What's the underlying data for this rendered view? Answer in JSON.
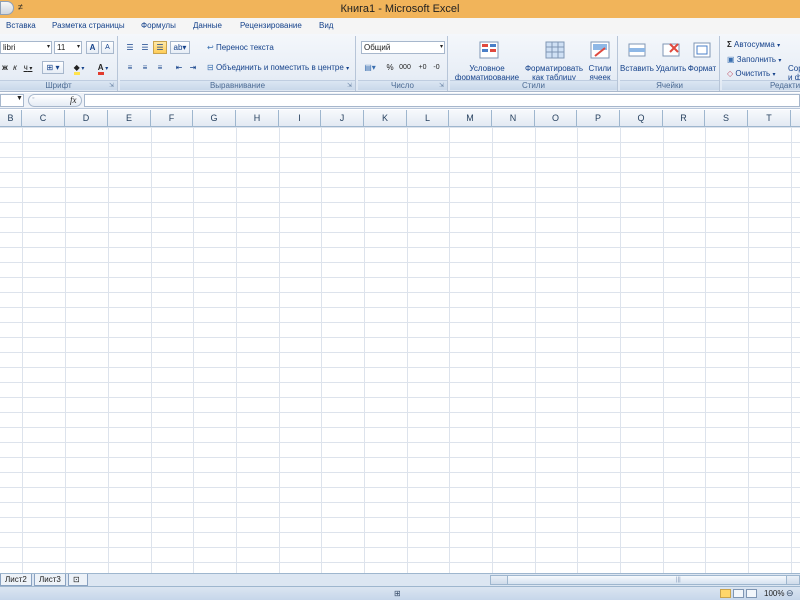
{
  "window": {
    "title": "Книга1 - Microsoft Excel"
  },
  "quick_access": {
    "customize_glyph": "≠"
  },
  "ribbon_tabs": [
    "Вставка",
    "Разметка страницы",
    "Формулы",
    "Данные",
    "Рецензирование",
    "Вид"
  ],
  "ribbon": {
    "font": {
      "group_label": "Шрифт",
      "font_name": "libri",
      "font_size": "11",
      "grow_label": "A",
      "shrink_label": "A",
      "bold": "ж",
      "italic": "к",
      "underline": "ч",
      "font_color_label": "A"
    },
    "alignment": {
      "group_label": "Выравнивание",
      "wrap_text": "Перенос текста",
      "merge_center": "Объединить и поместить в центре"
    },
    "number": {
      "group_label": "Число",
      "format_value": "Общий",
      "percent": "%",
      "thousands": "000",
      "increase_decimal": "+0",
      "decrease_decimal": "-0"
    },
    "styles": {
      "group_label": "Стили",
      "conditional_formatting_line1": "Условное",
      "conditional_formatting_line2": "форматирование",
      "format_as_table_line1": "Форматировать",
      "format_as_table_line2": "как таблицу",
      "cell_styles_line1": "Стили",
      "cell_styles_line2": "ячеек"
    },
    "cells": {
      "group_label": "Ячейки",
      "insert": "Вставить",
      "delete": "Удалить",
      "format": "Формат"
    },
    "editing": {
      "group_label": "Редакти",
      "autosum": "Автосумма",
      "fill": "Заполнить",
      "clear": "Очистить",
      "sort_line1": "Сор",
      "sort_line2": "и ф"
    }
  },
  "formula_bar": {
    "fx_label": "fx",
    "name_value": "",
    "formula_value": ""
  },
  "columns": [
    "B",
    "C",
    "D",
    "E",
    "F",
    "G",
    "H",
    "I",
    "J",
    "K",
    "L",
    "M",
    "N",
    "O",
    "P",
    "Q",
    "R",
    "S",
    "T"
  ],
  "sheets": [
    "Лист2",
    "Лист3"
  ],
  "status_bar": {
    "zoom": "100%",
    "macro_label": "⊞"
  },
  "colors": {
    "title_bar": "#f1b45a",
    "ribbon_text": "#15428b",
    "gridline": "#dde3ec",
    "header_border": "#9eb6ce"
  }
}
